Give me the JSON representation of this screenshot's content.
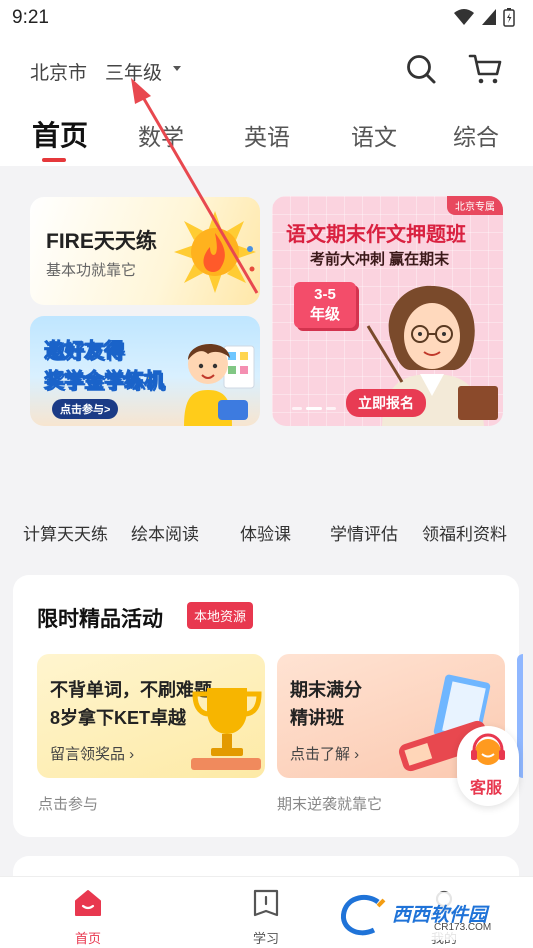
{
  "status_bar": {
    "time": "9:21"
  },
  "header": {
    "city": "北京市",
    "grade": "三年级",
    "search_icon": "search-icon",
    "cart_icon": "cart-icon"
  },
  "tabs": [
    {
      "label": "首页",
      "active": true
    },
    {
      "label": "数学"
    },
    {
      "label": "英语"
    },
    {
      "label": "语文"
    },
    {
      "label": "综合"
    }
  ],
  "banners": {
    "fire": {
      "title": "FIRE天天练",
      "subtitle": "基本功就靠它"
    },
    "invite": {
      "line1": "邀好友得",
      "line2": "奖学金学练机",
      "button": "点击参与>"
    },
    "essay": {
      "badge": "北京专属",
      "title": "语文期末作文押题班",
      "subtitle": "考前大冲刺 赢在期末",
      "grade_tag_line1": "3-5",
      "grade_tag_line2": "年级",
      "button": "立即报名"
    }
  },
  "quick_nav": [
    "计算天天练",
    "绘本阅读",
    "体验课",
    "学情评估",
    "领福利资料"
  ],
  "activities": {
    "title": "限时精品活动",
    "tag": "本地资源",
    "items": [
      {
        "line1": "不背单词，不刷难题",
        "line2": "8岁拿下KET卓越",
        "link": "留言领奖品",
        "caption": "点击参与"
      },
      {
        "line1": "期末满分",
        "line2": "精讲班",
        "link": "点击了解",
        "caption": "期末逆袭就靠它"
      }
    ]
  },
  "service": {
    "label": "客服"
  },
  "bottom_nav": [
    {
      "label": "首页",
      "active": true
    },
    {
      "label": "学习"
    },
    {
      "label": "我的"
    }
  ],
  "watermark": {
    "text": "西西软件园",
    "sub": "CR173.COM"
  },
  "colors": {
    "accent": "#e8384f",
    "text": "#222222",
    "background": "#f3f3f5"
  }
}
